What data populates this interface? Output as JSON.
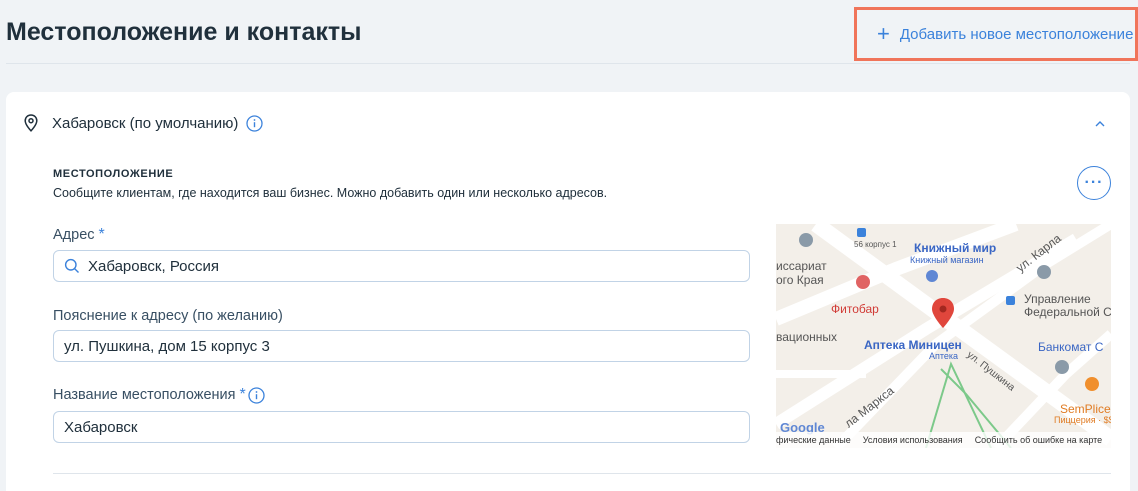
{
  "header": {
    "title": "Местоположение и контакты",
    "add_location_label": "Добавить новое местоположение"
  },
  "location": {
    "name": "Хабаровск (по умолчанию)",
    "section_label": "МЕСТОПОЛОЖЕНИЕ",
    "section_description": "Сообщите клиентам, где находится ваш бизнес. Можно добавить один или несколько адресов.",
    "more_label": "···"
  },
  "form": {
    "address_label": "Адрес",
    "address_value": "Хабаровск, Россия",
    "address_note_label": "Пояснение к адресу (по желанию)",
    "address_note_value": "ул. Пушкина, дом 15 корпус 3",
    "location_name_label": "Название местоположения",
    "location_name_value": "Хабаровск",
    "required_mark": "*"
  },
  "map": {
    "labels": {
      "stop_number": "56 корпус 1",
      "bookstore": "Книжный мир",
      "bookstore_sub": "Книжный магазин",
      "commissariat": "иссариат",
      "krai": "ого Края",
      "fitobar": "Фитобар",
      "street_karla": "ул. Карла",
      "upravlenie": "Управление",
      "federal": "Федеральной С",
      "vacation": "вационных",
      "apteka": "Аптека Миницен",
      "apteka_sub": "Аптека",
      "bankomat": "Банкомат С",
      "street_pushkina": "ул. Пушкина",
      "street_marksa": "ла Маркса",
      "semplice": "SemPlice",
      "pizzeria": "Пиццерия · $$",
      "google": "Google"
    },
    "footer": {
      "map_data": "фические данные",
      "terms": "Условия использования",
      "report": "Сообщить об ошибке на карте"
    }
  },
  "colors": {
    "accent": "#3b82db",
    "highlight": "#f0745a",
    "map_red": "#e0463c"
  }
}
